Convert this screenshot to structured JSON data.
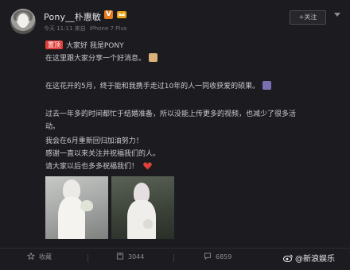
{
  "post": {
    "username": "Pony__朴惠敏",
    "verified_label": "V",
    "meta_time": "今天 11:11 来自",
    "meta_device": "iPhone 7 Plus",
    "follow_label": "+关注",
    "pin_label": "置顶",
    "lines": [
      "大家好 我是PONY",
      "在这里跟大家分享一个好消息。",
      "在这花开的5月，终于能和我携手走过10年的人一同收获爱的硕果。",
      "过去一年多的时间都忙于结婚准备，所以没能上传更多的视频，也减少了很多活",
      "动。",
      "我会在6月重新回归加油努力！",
      "感谢一直以来关注并祝福我们的人。",
      "请大家以后也多多祝福我们！"
    ]
  },
  "actions": {
    "favorite_label": "收藏",
    "repost_count": "3044",
    "comment_count": "6859"
  },
  "watermark": {
    "text": "@新浪娱乐"
  },
  "icons": {
    "verified": "verified-badge-icon",
    "crown": "crown-icon",
    "caret": "chevron-down-icon",
    "favorite": "star-icon",
    "repost": "repost-icon",
    "comment": "comment-icon",
    "heart": "heart-icon"
  },
  "colors": {
    "background": "#1c1c20",
    "pin": "#e0403a",
    "verified": "#e8791c",
    "heart": "#e0403a"
  }
}
